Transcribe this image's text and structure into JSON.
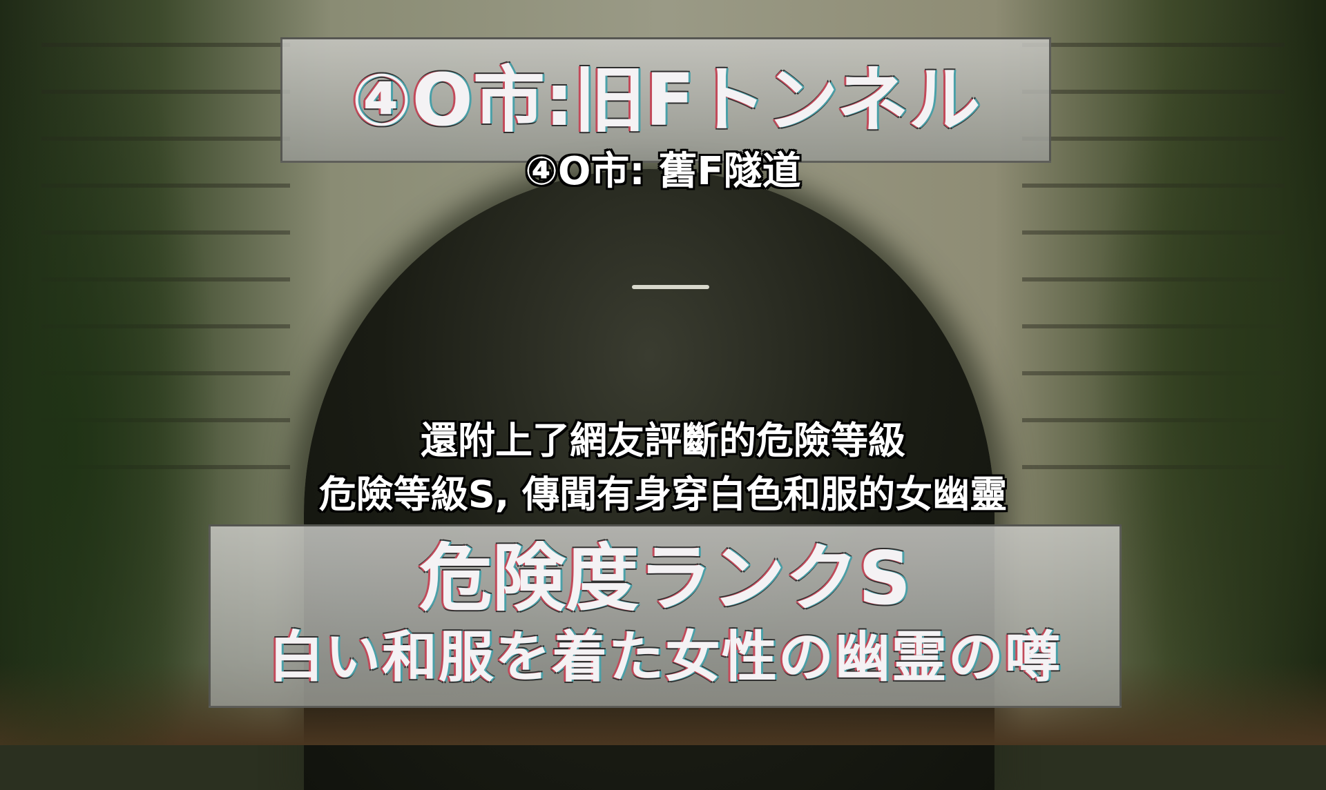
{
  "sign_top": {
    "title": "④O市:旧Fトンネル"
  },
  "subtitle_top": {
    "text": "④O市: 舊F隧道"
  },
  "subtitles": {
    "line1": "還附上了網友評斷的危險等級",
    "line2": "危險等級S, 傳聞有身穿白色和服的女幽靈"
  },
  "sign_bottom": {
    "rank": "危険度ランクS",
    "rumor": "白い和服を着た女性の幽霊の噂"
  }
}
